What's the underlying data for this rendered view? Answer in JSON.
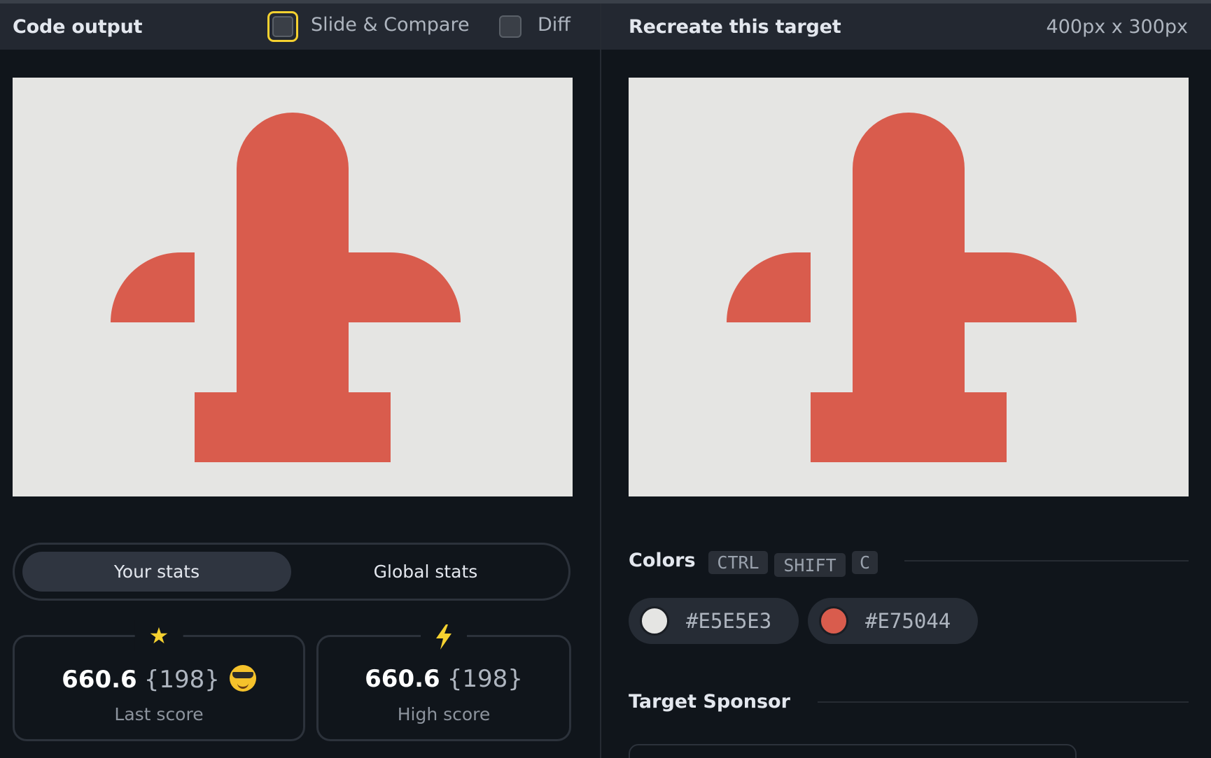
{
  "header": {
    "left_title": "Code output",
    "slide_compare_label": "Slide & Compare",
    "diff_label": "Diff",
    "right_title": "Recreate this target",
    "dimensions": "400px x 300px"
  },
  "stats": {
    "tabs": [
      "Your stats",
      "Global stats"
    ],
    "last_score": {
      "value": "660.6",
      "count": "{198}",
      "label": "Last score",
      "icon": "star-icon",
      "emoji": "sunglasses-face-icon"
    },
    "high_score": {
      "value": "660.6",
      "count": "{198}",
      "label": "High score",
      "icon": "lightning-icon"
    }
  },
  "colors": {
    "title": "Colors",
    "shortcut": [
      "CTRL",
      "SHIFT",
      "C"
    ],
    "swatches": [
      {
        "hex": "#E5E5E3"
      },
      {
        "hex": "#E75044"
      }
    ]
  },
  "sponsor": {
    "title": "Target Sponsor"
  },
  "theme": {
    "canvas_bg": "#e5e5e3",
    "shape_color": "#d95c4d",
    "accent": "#f5d130"
  }
}
